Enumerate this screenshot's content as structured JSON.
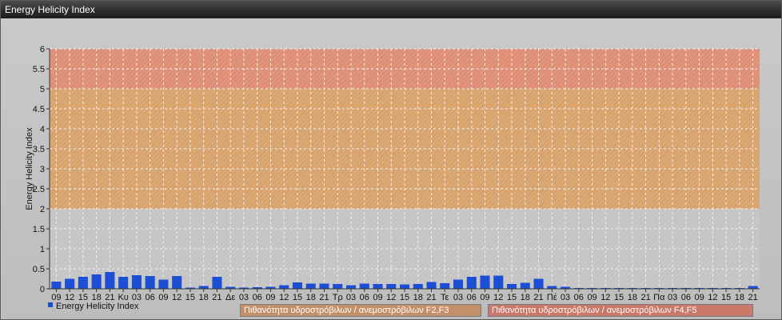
{
  "window": {
    "title": "Energy Helicity Index"
  },
  "colors": {
    "bar": "#1d4fd6",
    "band_low": "#c4c4c4",
    "band_mid": "#d9a066",
    "band_high": "#e08a70"
  },
  "legend": {
    "series_label": "Energy Helicity Index",
    "band1_label": "Πιθανότητα υδροστρόβιλων / ανεμοστρόβιλων F2,F3",
    "band2_label": "Πιθανότητα υδροστρόβιλων / ανεμοστρόβιλων F4,F5",
    "band1_color": "#c4906a",
    "band2_color": "#c9786a"
  },
  "chart_data": {
    "type": "bar",
    "title": "",
    "xlabel": "",
    "ylabel": "Energy Helicity Index",
    "ylim": [
      0,
      6
    ],
    "yticks": [
      "0",
      "0.5",
      "1",
      "1.5",
      "2",
      "2.5",
      "3",
      "3.5",
      "4",
      "4.5",
      "5",
      "5.5",
      "6"
    ],
    "grid": true,
    "bands": [
      {
        "from": 0,
        "to": 2,
        "color": "#c4c4c4"
      },
      {
        "from": 2,
        "to": 5,
        "color": "#d9a066"
      },
      {
        "from": 5,
        "to": 6,
        "color": "#e08a70"
      }
    ],
    "categories": [
      "09",
      "12",
      "15",
      "18",
      "21",
      "Κυ",
      "03",
      "06",
      "09",
      "12",
      "15",
      "18",
      "21",
      "Δε",
      "03",
      "06",
      "09",
      "12",
      "15",
      "18",
      "21",
      "Τρ",
      "03",
      "06",
      "09",
      "12",
      "15",
      "18",
      "21",
      "Τε",
      "03",
      "06",
      "09",
      "12",
      "15",
      "18",
      "21",
      "Πέ",
      "03",
      "06",
      "09",
      "12",
      "15",
      "18",
      "21",
      "Πα",
      "03",
      "06",
      "09",
      "12",
      "15",
      "18",
      "21"
    ],
    "series": [
      {
        "name": "Energy Helicity Index",
        "values": [
          0.18,
          0.25,
          0.3,
          0.36,
          0.42,
          0.3,
          0.34,
          0.32,
          0.23,
          0.32,
          0.03,
          0.07,
          0.3,
          0.05,
          0.03,
          0.04,
          0.05,
          0.09,
          0.16,
          0.13,
          0.13,
          0.12,
          0.09,
          0.13,
          0.12,
          0.12,
          0.11,
          0.12,
          0.17,
          0.14,
          0.23,
          0.3,
          0.33,
          0.33,
          0.12,
          0.15,
          0.25,
          0.07,
          0.05,
          0.02,
          0.02,
          0.02,
          0.02,
          0.02,
          0.02,
          0.02,
          0.02,
          0.02,
          0.02,
          0.02,
          0.02,
          0.02,
          0.07,
          0.02
        ]
      }
    ]
  }
}
